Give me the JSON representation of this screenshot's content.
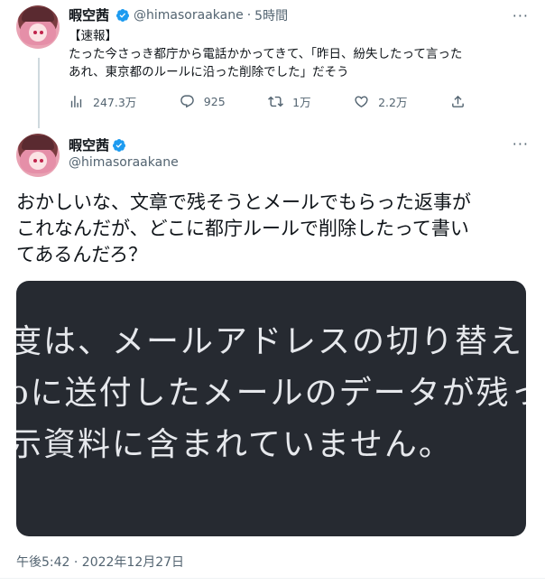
{
  "tweet1": {
    "display_name": "暇空茜",
    "handle": "@himasoraakane",
    "separator": "·",
    "time": "5時間",
    "text": "【速報】\nたった今さっき都庁から電話かかってきて、「昨日、紛失したって言った\nあれ、東京都のルールに沿った削除でした」だそう",
    "actions": {
      "views": "247.3万",
      "replies": "925",
      "retweets": "1万",
      "likes": "2.2万"
    },
    "more_label": "···"
  },
  "tweet2": {
    "display_name": "暇空茜",
    "handle": "@himasoraakane",
    "text": "おかしいな、文章で残そうとメールでもらった返事が\nこれなんだが、どこに都庁ルールで削除したって書い\nてあるんだろ？",
    "media_lines": [
      "度は、メールアドレスの切り替えに",
      "oに送付したメールのデータが残っ",
      "示資料に含まれていません。"
    ],
    "timestamp": "午後5:42 · 2022年12月27日",
    "more_label": "···"
  },
  "colors": {
    "verified": "#1d9bf0",
    "secondary_text": "#536471",
    "media_bg": "#262a31"
  },
  "icons": [
    "verified-badge-icon",
    "views-icon",
    "reply-icon",
    "retweet-icon",
    "like-icon",
    "share-icon",
    "more-icon"
  ]
}
